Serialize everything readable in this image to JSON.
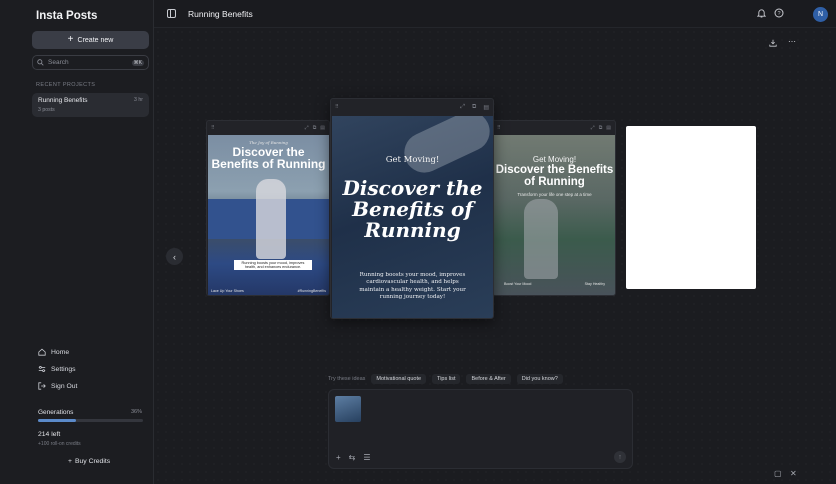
{
  "app": {
    "title": "Insta Posts"
  },
  "sidebar": {
    "create_label": "Create new",
    "search_placeholder": "Search",
    "search_shortcut": "⌘K",
    "recent_label": "RECENT PROJECTS",
    "projects": [
      {
        "name": "Running Benefits",
        "count": "3 posts",
        "age": "3 hr"
      }
    ],
    "nav": [
      {
        "label": "Home",
        "icon": "home-icon"
      },
      {
        "label": "Settings",
        "icon": "sliders-icon"
      },
      {
        "label": "Sign Out",
        "icon": "sign-out-icon"
      }
    ],
    "generations": {
      "label": "Generations",
      "percent": "36%",
      "fraction": 0.36,
      "left": "214 left",
      "sub": "+100 roll-on credits"
    },
    "buy_label": "Buy Credits"
  },
  "header": {
    "title": "Running Benefits",
    "avatar_initial": "N",
    "icons": [
      "bell-icon",
      "help-icon"
    ]
  },
  "posts": [
    {
      "kicker": "The Joy of Running",
      "headline": "Discover the Benefits of Running",
      "body": "Running boosts your mood, improves health, and enhances endurance.",
      "tag_left": "Lace Up Your Shoes",
      "tag_right": "#RunningBenefits"
    },
    {
      "kicker": "Get Moving!",
      "headline": "Discover the Benefits of Running",
      "body": "Running boosts your mood, improves cardiovascular health, and helps maintain a healthy weight. Start your running journey today!"
    },
    {
      "kicker": "Get Moving!",
      "headline": "Discover the Benefits of Running",
      "subtitle": "Transform your life one step at a time",
      "tag_left": "Boost Your Mood",
      "tag_right": "Stay Healthy"
    }
  ],
  "ideas": {
    "label": "Try these ideas",
    "chips": [
      "Motivational quote",
      "Tips list",
      "Before & After",
      "Did you know?"
    ]
  },
  "colors": {
    "accent": "#5b8ac9",
    "avatar": "#2f5fa6"
  }
}
